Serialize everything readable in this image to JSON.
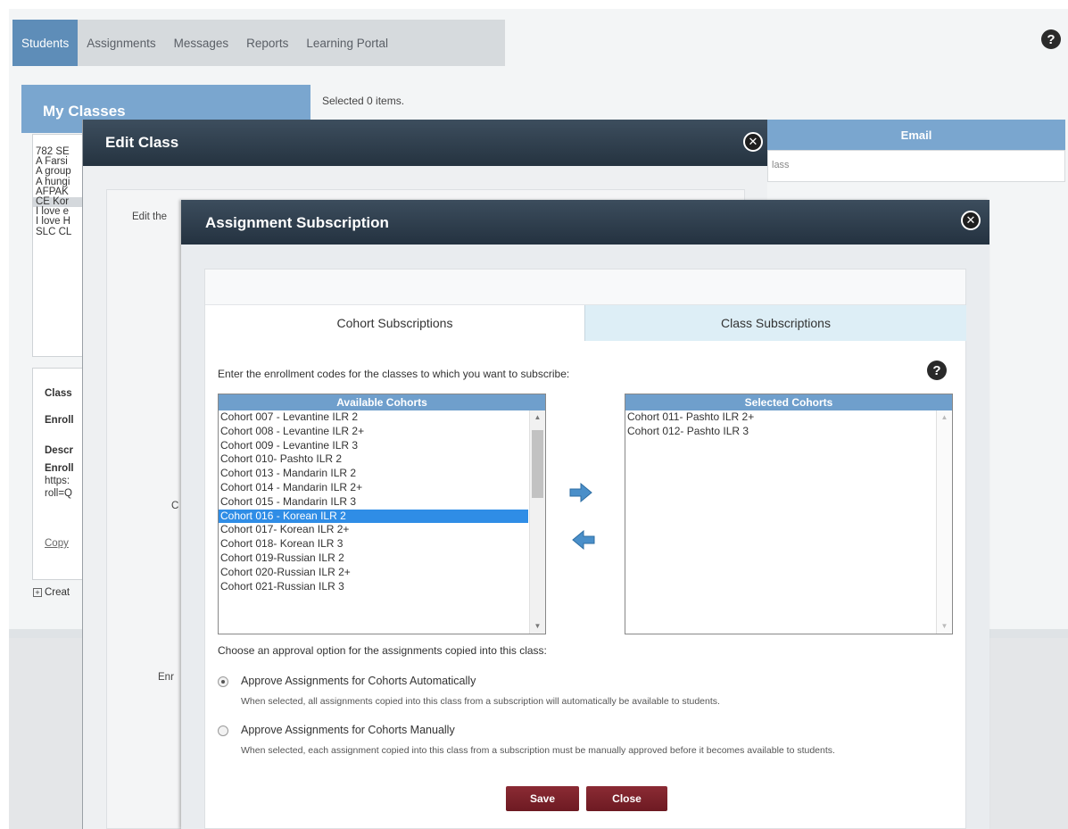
{
  "nav": {
    "tabs": [
      {
        "label": "Students",
        "active": true
      },
      {
        "label": "Assignments",
        "active": false
      },
      {
        "label": "Messages",
        "active": false
      },
      {
        "label": "Reports",
        "active": false
      },
      {
        "label": "Learning Portal",
        "active": false
      }
    ],
    "help_icon": "question-circle-icon"
  },
  "my_classes": {
    "title": "My Classes",
    "items": [
      "782 SE",
      "A Farsi",
      "A group",
      "A hungi",
      "AFPAK",
      "CE Kor",
      "I love e",
      "I love H",
      "SLC CL"
    ],
    "details": [
      "Class",
      "Enroll",
      "Descr",
      "Enroll",
      "https:",
      "roll=Q",
      "Copy"
    ],
    "create_label": "Creat"
  },
  "main": {
    "selected_count": "Selected 0 items.",
    "email_header": "Email",
    "email_row_text": "lass"
  },
  "edit_class": {
    "title": "Edit Class",
    "label_edit": "Edit the",
    "label_c": "C",
    "label_enr": "Enr"
  },
  "assignment_subscription": {
    "title": "Assignment Subscription",
    "tabs": {
      "cohort": "Cohort Subscriptions",
      "class": "Class Subscriptions"
    },
    "instruction": "Enter the enrollment codes for the classes to which you want to subscribe:",
    "available": {
      "header": "Available Cohorts",
      "items": [
        "Cohort 007 - Levantine ILR 2",
        "Cohort 008 - Levantine ILR 2+",
        "Cohort 009 - Levantine ILR 3",
        "Cohort 010- Pashto ILR 2",
        "Cohort 013 - Mandarin ILR 2",
        "Cohort 014 - Mandarin ILR 2+",
        "Cohort 015 - Mandarin ILR 3",
        "Cohort 016 - Korean ILR 2",
        "Cohort 017- Korean ILR 2+",
        "Cohort 018- Korean ILR 3",
        "Cohort 019-Russian ILR 2",
        "Cohort 020-Russian ILR 2+",
        "Cohort 021-Russian ILR 3"
      ],
      "selected_index": 7
    },
    "selected": {
      "header": "Selected Cohorts",
      "items": [
        "Cohort 011- Pashto ILR 2+",
        "Cohort 012- Pashto ILR 3"
      ]
    },
    "approval_question": "Choose an approval option for the assignments copied into this class:",
    "options": [
      {
        "label": "Approve Assignments for Cohorts Automatically",
        "description": "When selected, all assignments copied into this class from a subscription will automatically be available to students.",
        "checked": true
      },
      {
        "label": "Approve Assignments for Cohorts Manually",
        "description": "When selected, each assignment copied into this class from a subscription must be manually approved before it becomes available to students.",
        "checked": false
      }
    ],
    "buttons": {
      "save": "Save",
      "close": "Close"
    }
  },
  "colors": {
    "tab_active": "#5e8db8",
    "header_blue": "#7aa6cf",
    "dialog_title": "#2f3f4e",
    "list_select": "#2f8de6",
    "button": "#7a2129"
  }
}
